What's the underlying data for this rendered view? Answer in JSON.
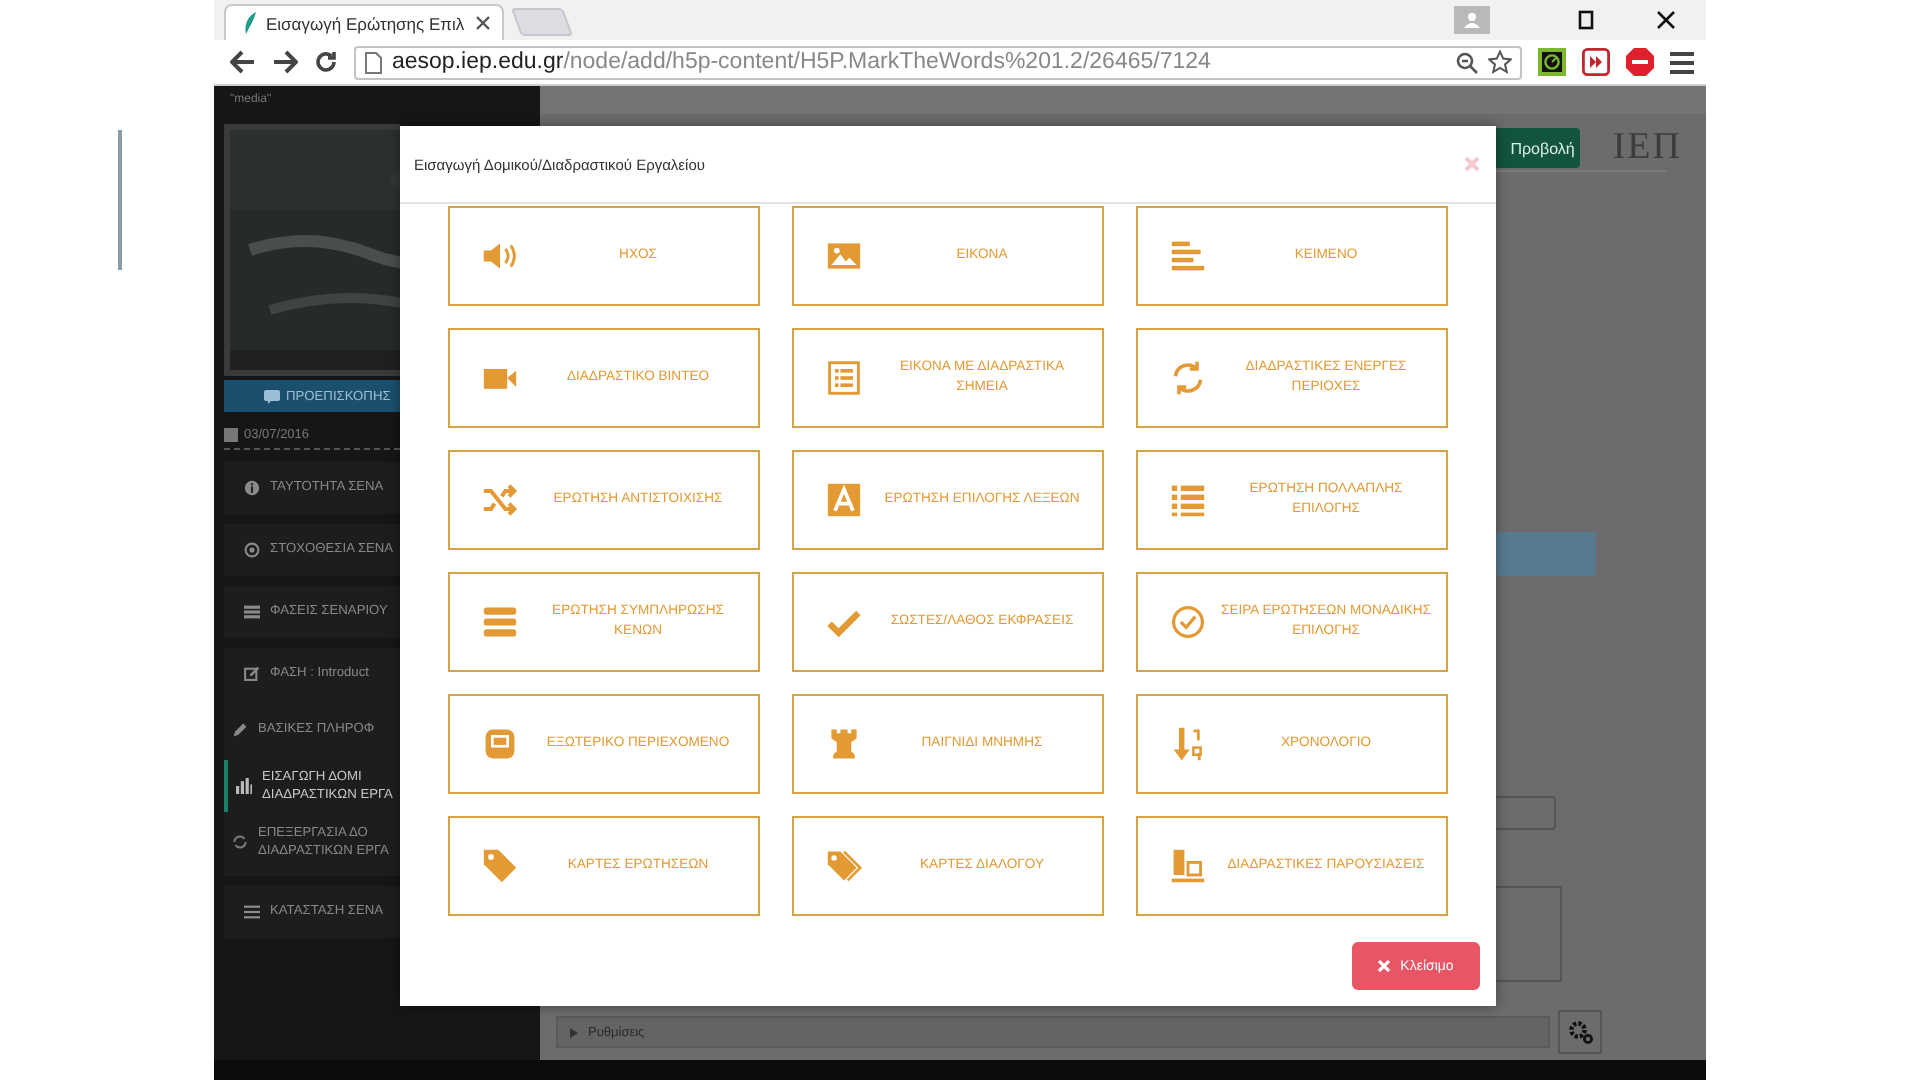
{
  "browser": {
    "tab_title": "Εισαγωγή Ερώτησης Επιλ",
    "url_host": "aesop.iep.edu.gr",
    "url_path": "/node/add/h5p-content/H5P.MarkTheWords%201.2/26465/7124"
  },
  "sidebar": {
    "caption": "\"media\"",
    "preview_button": "ΠΡΟΕΠΙΣΚΟΠΗΣ",
    "date": "03/07/2016",
    "items": [
      {
        "label": "ΤΑΥΤΟΤΗΤΑ ΣΕΝΑ",
        "selected": false
      },
      {
        "label": "ΣΤΟΧΟΘΕΣΙΑ ΣΕΝΑ",
        "selected": false
      },
      {
        "label": "ΦΑΣΕΙΣ ΣΕΝΑΡΙΟΥ",
        "selected": false
      },
      {
        "label": "ΦΑΣΗ : Introduct",
        "selected": false,
        "children": [
          {
            "label": "ΒΑΣΙΚΕΣ ΠΛΗΡΟΦ",
            "selected": false
          },
          {
            "label": "ΕΙΣΑΓΩΓΗ ΔΟΜΙ\nΔΙΑΔΡΑΣΤΙΚΩΝ ΕΡΓΑ",
            "selected": true
          },
          {
            "label": "ΕΠΕΞΕΡΓΑΣΙΑ ΔΟ\nΔΙΑΔΡΑΣΤΙΚΩΝ ΕΡΓΑ",
            "selected": false
          }
        ]
      },
      {
        "label": "ΚΑΤΑΣΤΑΣΗ ΣΕΝΑ",
        "selected": false
      }
    ]
  },
  "main": {
    "view_button": "Προβολή",
    "logo": "ΙΕΠ",
    "settings": "Ρυθμίσεις"
  },
  "modal": {
    "title": "Εισαγωγή Δομικού/Διαδραστικού Εργαλείου",
    "close_button": "Κλείσιμο",
    "tools": [
      {
        "label": "ΗΧΟΣ"
      },
      {
        "label": "ΕΙΚΟΝΑ"
      },
      {
        "label": "ΚΕΙΜΕΝΟ"
      },
      {
        "label": "ΔΙΑΔΡΑΣΤΙΚΟ ΒΙΝΤΕΟ"
      },
      {
        "label": "ΕΙΚΟΝΑ ΜΕ ΔΙΑΔΡΑΣΤΙΚΑ ΣΗΜΕΙΑ"
      },
      {
        "label": "ΔΙΑΔΡΑΣΤΙΚΕΣ ΕΝΕΡΓΕΣ ΠΕΡΙΟΧΕΣ"
      },
      {
        "label": "ΕΡΩΤΗΣΗ ΑΝΤΙΣΤΟΙΧΙΣΗΣ"
      },
      {
        "label": "ΕΡΩΤΗΣΗ ΕΠΙΛΟΓΗΣ ΛΕΞΕΩΝ"
      },
      {
        "label": "ΕΡΩΤΗΣΗ ΠΟΛΛΑΠΛΗΣ ΕΠΙΛΟΓΗΣ"
      },
      {
        "label": "ΕΡΩΤΗΣΗ ΣΥΜΠΛΗΡΩΣΗΣ ΚΕΝΩΝ"
      },
      {
        "label": "ΣΩΣΤΕΣ/ΛΑΘΟΣ ΕΚΦΡΑΣΕΙΣ"
      },
      {
        "label": "ΣΕΙΡΑ ΕΡΩΤΗΣΕΩΝ ΜΟΝΑΔΙΚΗΣ ΕΠΙΛΟΓΗΣ"
      },
      {
        "label": "ΕΞΩΤΕΡΙΚΟ ΠΕΡΙΕΧΟΜΕΝΟ"
      },
      {
        "label": "ΠΑΙΓΝΙΔΙ ΜΝΗΜΗΣ"
      },
      {
        "label": "ΧΡΟΝΟΛΟΓΙΟ"
      },
      {
        "label": "ΚΑΡΤΕΣ ΕΡΩΤΗΣΕΩΝ"
      },
      {
        "label": "ΚΑΡΤΕΣ ΔΙΑΛΟΓΟΥ"
      },
      {
        "label": "ΔΙΑΔΡΑΣΤΙΚΕΣ ΠΑΡΟΥΣΙΑΣΕΙΣ"
      }
    ]
  }
}
